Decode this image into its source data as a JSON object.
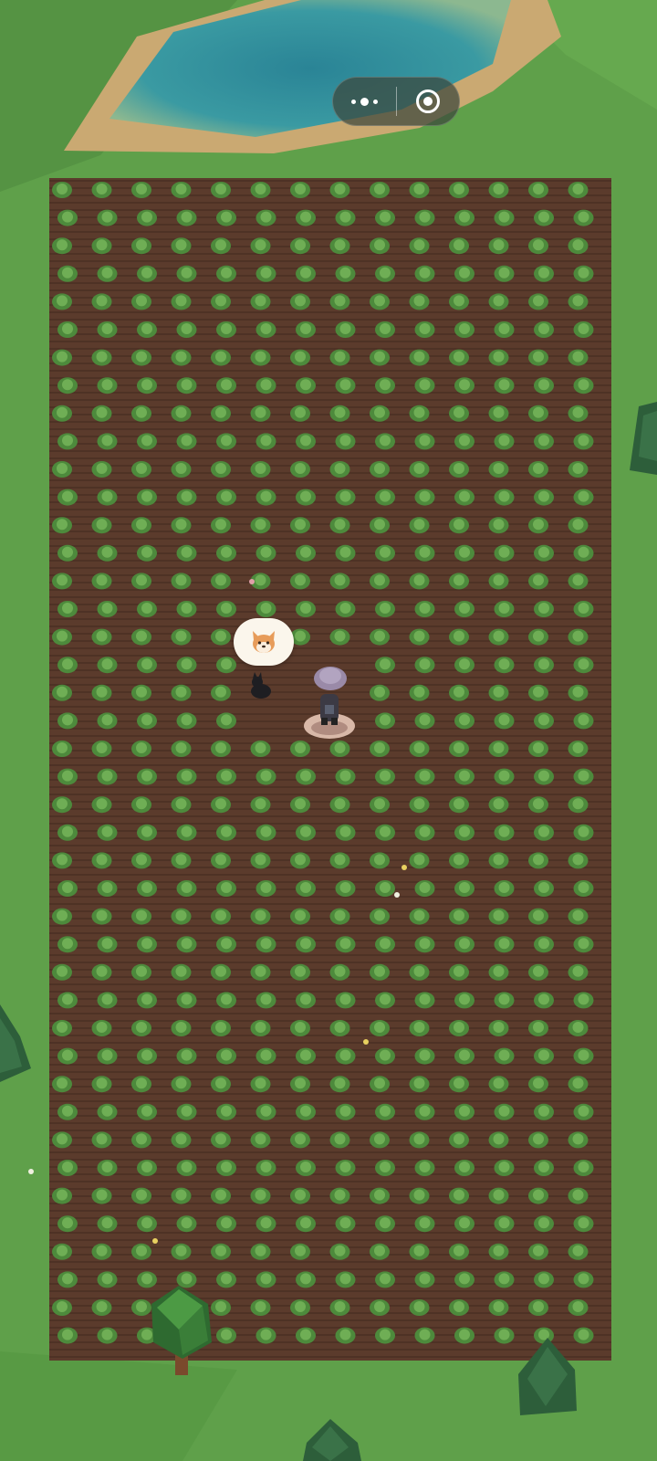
{
  "app": {
    "miniprogram_capsule": {
      "menu_icon": "three-dots-icon",
      "close_icon": "record-target-icon"
    }
  },
  "scene": {
    "ground_color": "#5fa04a",
    "pond_color": "#2e8fa0",
    "field_soil_color": "#5b3b2c",
    "crop_color": "#5d9a45",
    "field": {
      "crop": "cabbage",
      "columns": 14,
      "rows": 42
    },
    "player": {
      "hat_color": "#9a8aa8",
      "shadow_pad_color": "#d8b8a8"
    },
    "pet": {
      "type": "black-cat",
      "speech_bubble_icon": "shiba-dog-face-icon"
    },
    "trees": [
      "pine-tree",
      "pine-tree",
      "pine-tree",
      "pine-tree",
      "round-tree"
    ]
  }
}
